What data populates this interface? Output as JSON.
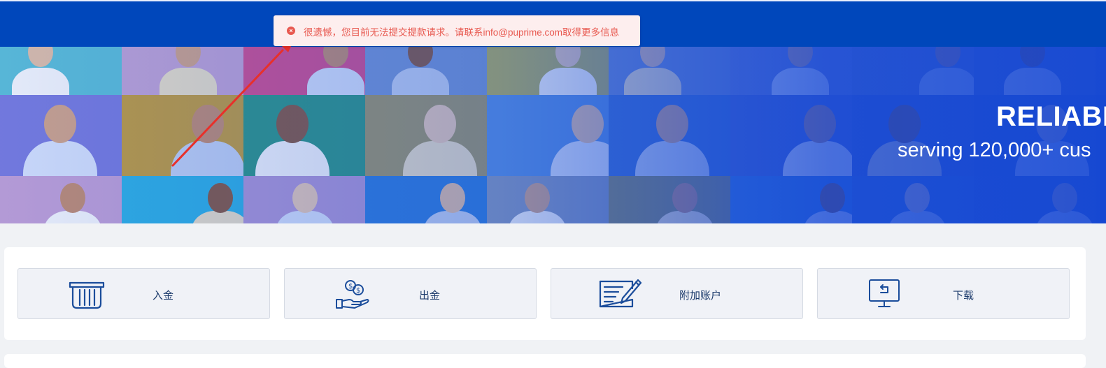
{
  "toast": {
    "icon": "error-circle-icon",
    "message": "很遗憾，您目前无法提交提款请求。请联系info@puprime.com取得更多信息",
    "color": "#e8584f",
    "background": "#fdeeee"
  },
  "banner": {
    "title": "RELIABL",
    "subtitle": "serving 120,000+ cus"
  },
  "actions": [
    {
      "label": "入金",
      "icon": "atm-card-icon"
    },
    {
      "label": "出金",
      "icon": "hand-coins-icon"
    },
    {
      "label": "附加账户",
      "icon": "document-pen-icon"
    },
    {
      "label": "下载",
      "icon": "monitor-download-icon"
    }
  ],
  "colors": {
    "header": "#0047bb",
    "icon": "#1b4d9b",
    "annotation_arrow": "#e8302a"
  }
}
